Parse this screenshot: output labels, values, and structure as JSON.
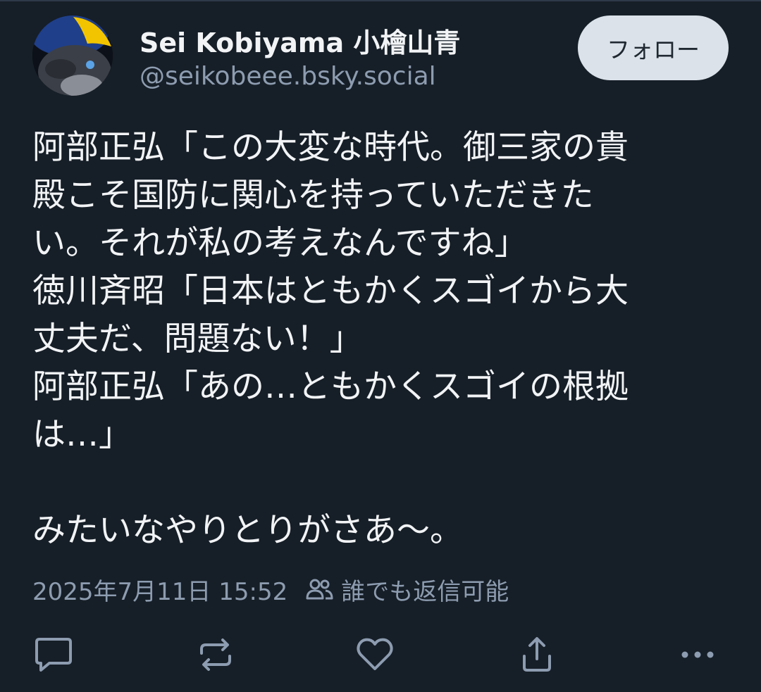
{
  "author": {
    "display_name": "Sei Kobiyama 小檜山青",
    "handle": "@seikobeee.bsky.social"
  },
  "follow_label": "フォロー",
  "post": {
    "lines": [
      "阿部正弘「この大変な時代。御三家の貴",
      "殿こそ国防に関心を持っていただきた",
      "い。それが私の考えなんですね」",
      "徳川斉昭「日本はともかくスゴイから大",
      "丈夫だ、問題ない！」",
      "阿部正弘「あの…ともかくスゴイの根拠",
      "は…」",
      "",
      "みたいなやりとりがさあ〜。"
    ]
  },
  "meta": {
    "timestamp": "2025年7月11日 15:52",
    "reply_setting": "誰でも返信可能",
    "reply_setting_icon": "people-icon"
  },
  "actions": {
    "icons": [
      "reply-icon",
      "repost-icon",
      "like-icon",
      "share-icon",
      "more-icon"
    ]
  },
  "colors": {
    "background": "#161e27",
    "text": "#f1f3f5",
    "muted": "#8d9cb0",
    "follow_button_bg": "#dbe2ea"
  }
}
